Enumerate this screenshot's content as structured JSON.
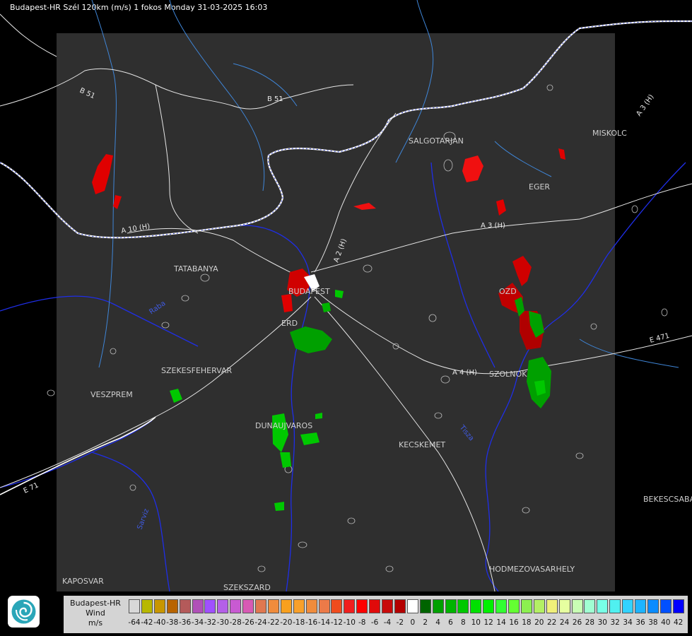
{
  "header": {
    "title": "Budapest-HR Szél 120km (m/s) 1 fokos Monday 31-03-2025 16:03"
  },
  "map": {
    "cities": [
      {
        "id": "salgotarjan",
        "name": "SALGOTARJAN"
      },
      {
        "id": "miskolc",
        "name": "MISKOLC"
      },
      {
        "id": "eger",
        "name": "EGER"
      },
      {
        "id": "tatabanya",
        "name": "TATABANYA"
      },
      {
        "id": "budapest",
        "name": "BUDAPEST"
      },
      {
        "id": "erd",
        "name": "ERD"
      },
      {
        "id": "szekesfehervar",
        "name": "SZEKESFEHERVAR"
      },
      {
        "id": "veszprem",
        "name": "VESZPREM"
      },
      {
        "id": "dunaujvaros",
        "name": "DUNAUJVAROS"
      },
      {
        "id": "kecskemet",
        "name": "KECSKEMET"
      },
      {
        "id": "szolnok",
        "name": "SZOLNOK"
      },
      {
        "id": "bekescsaba",
        "name": "BEKESCSABA"
      },
      {
        "id": "hodmezovasarhely",
        "name": "HODMEZOVASARHELY"
      },
      {
        "id": "kaposvar",
        "name": "KAPOSVAR"
      },
      {
        "id": "szekszard",
        "name": "SZEKSZARD"
      },
      {
        "id": "ozd",
        "name": "OZD"
      }
    ],
    "roads": [
      {
        "id": "b51a",
        "name": "B 51"
      },
      {
        "id": "b51b",
        "name": "B 51"
      },
      {
        "id": "a3a",
        "name": "A 3 (H)"
      },
      {
        "id": "a3b",
        "name": "A 3 (H)"
      },
      {
        "id": "a2",
        "name": "A 2 (H)"
      },
      {
        "id": "a4",
        "name": "A 4 (H)"
      },
      {
        "id": "e471",
        "name": "E 471"
      },
      {
        "id": "e71",
        "name": "E 71"
      },
      {
        "id": "a10",
        "name": "A 10 (H)"
      }
    ],
    "rivers": [
      {
        "id": "raba",
        "name": "Raba"
      },
      {
        "id": "tisza",
        "name": "Tisza"
      },
      {
        "id": "sarviz",
        "name": "Sarviz"
      }
    ]
  },
  "legend": {
    "title": "Budapest-HR",
    "variable": "Wind",
    "unit": "m/s",
    "colors": [
      "#d8d8d8",
      "#b8b800",
      "#c89600",
      "#b86400",
      "#b45a5a",
      "#b050b8",
      "#a050ff",
      "#b460e8",
      "#c85ad2",
      "#d85ab4",
      "#e07850",
      "#f08c3c",
      "#f8a01e",
      "#f8a02a",
      "#f08c3c",
      "#ec7a48",
      "#f04c1e",
      "#f01e1e",
      "#ff0000",
      "#e00a0a",
      "#c80a0a",
      "#b40000",
      "#ffffff",
      "#006400",
      "#00a000",
      "#00b400",
      "#00c800",
      "#00e000",
      "#00f000",
      "#32ff32",
      "#64ff32",
      "#8cf050",
      "#b4f064",
      "#f0f07a",
      "#e6ffa0",
      "#c8ffb4",
      "#a0ffd2",
      "#78ffe6",
      "#50f0f0",
      "#32d2ff",
      "#1eb4ff",
      "#0a8cff",
      "#0050ff",
      "#0000ff"
    ],
    "ticks": [
      "-64",
      "-42",
      "-40",
      "-38",
      "-36",
      "-34",
      "-32",
      "-30",
      "-28",
      "-26",
      "-24",
      "-22",
      "-20",
      "-18",
      "-16",
      "-14",
      "-12",
      "-10",
      "-8",
      "-6",
      "-4",
      "-2",
      "0",
      "2",
      "4",
      "6",
      "8",
      "10",
      "12",
      "14",
      "16",
      "18",
      "20",
      "22",
      "24",
      "26",
      "28",
      "30",
      "32",
      "34",
      "36",
      "38",
      "40",
      "42"
    ]
  }
}
